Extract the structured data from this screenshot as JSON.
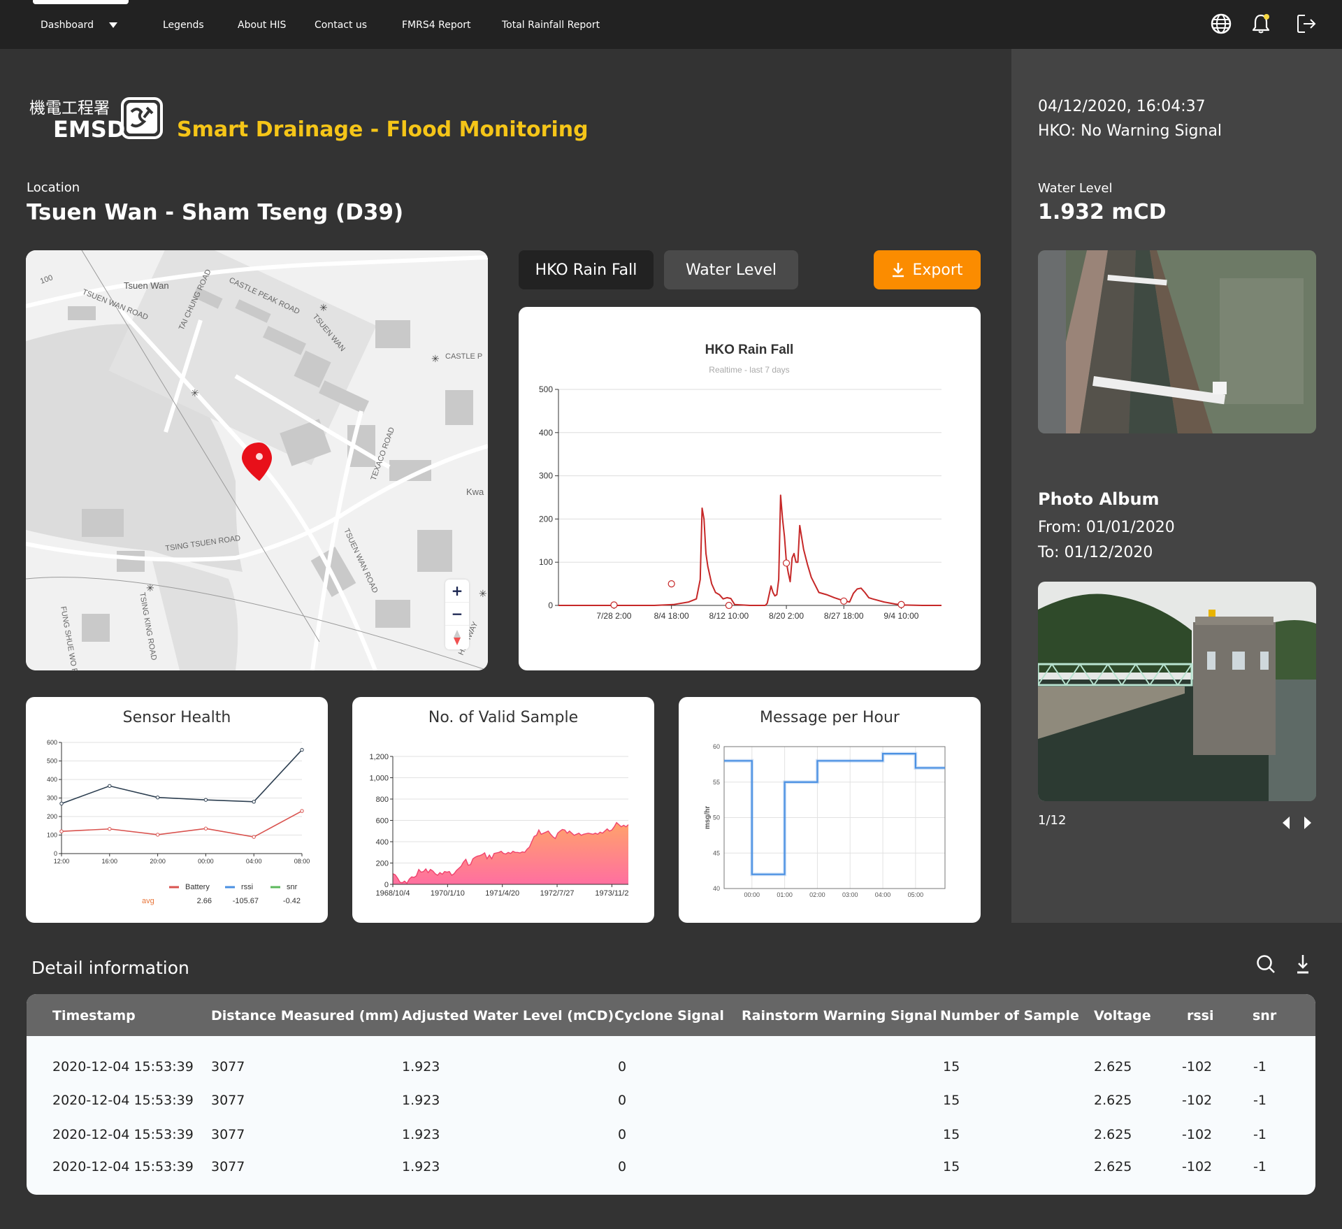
{
  "nav": {
    "items": [
      {
        "label": "Dashboard",
        "has_dropdown": true,
        "active": true
      },
      {
        "label": "Legends"
      },
      {
        "label": "About HIS"
      },
      {
        "label": "Contact us"
      },
      {
        "label": "FMRS4 Report"
      },
      {
        "label": "Total Rainfall Report"
      }
    ],
    "icons": [
      "globe-icon",
      "bell-icon",
      "logout-icon"
    ],
    "notification_dot_color": "#f5d742"
  },
  "brand": {
    "logo_chinese": "機電工程署",
    "logo_english": "EMSD",
    "app_title": "Smart Drainage - Flood Monitoring",
    "title_color": "#f5c518"
  },
  "location": {
    "label": "Location",
    "name": "Tsuen Wan - Sham Tseng (D39)"
  },
  "map": {
    "labels": [
      "Tsuen Wan",
      "TSUEN WAN ROAD",
      "CASTLE PEAK ROAD",
      "TAI CHUNG ROAD",
      "TSUEN WAN",
      "CASTLE P",
      "TEXACO ROAD",
      "TSING TSUEN ROAD",
      "TSUEN WAN ROAD",
      "TSING KING ROAD",
      "FUNG SHUE WO ROAD",
      "Kwa",
      "100",
      "HIGHWAY"
    ],
    "zoom_in": "+",
    "zoom_out": "−",
    "marker_color": "#e8101a"
  },
  "chart_tabs": {
    "tabs": [
      {
        "label": "HKO Rain Fall",
        "active": true
      },
      {
        "label": "Water Level",
        "active": false
      }
    ],
    "export_label": "Export",
    "export_color": "#fb8c00"
  },
  "right_panel": {
    "datetime": "04/12/2020, 16:04:37",
    "hko_status": "HKO: No Warning Signal",
    "water_level_label": "Water Level",
    "water_level_value": "1.932 mCD",
    "photo_album_title": "Photo Album",
    "from": "From: 01/01/2020",
    "to": "To: 01/12/2020",
    "photo_counter": "1/12"
  },
  "detail": {
    "title": "Detail information",
    "columns": [
      "Timestamp",
      "Distance Measured (mm)",
      "Adjusted Water Level (mCD)",
      "Cyclone Signal",
      "Rainstorm Warning Signal",
      "Number of Sample",
      "Voltage",
      "rssi",
      "snr"
    ],
    "rows": [
      [
        "2020-12-04 15:53:39",
        "3077",
        "1.923",
        "0",
        "",
        "15",
        "2.625",
        "-102",
        "-1"
      ],
      [
        "2020-12-04 15:53:39",
        "3077",
        "1.923",
        "0",
        "",
        "15",
        "2.625",
        "-102",
        "-1"
      ],
      [
        "2020-12-04 15:53:39",
        "3077",
        "1.923",
        "0",
        "",
        "15",
        "2.625",
        "-102",
        "-1"
      ],
      [
        "2020-12-04 15:53:39",
        "3077",
        "1.923",
        "0",
        "",
        "15",
        "2.625",
        "-102",
        "-1"
      ]
    ]
  },
  "chart_data": [
    {
      "id": "rain",
      "type": "line",
      "title": "HKO Rain Fall",
      "subtitle": "Realtime - last 7 days",
      "xlabel": "",
      "ylabel": "",
      "ylim": [
        0,
        500
      ],
      "yticks": [
        0,
        100,
        200,
        300,
        400,
        500
      ],
      "xticks": [
        "7/28 2:00",
        "8/4 18:00",
        "8/12 10:00",
        "8/20 2:00",
        "8/27 18:00",
        "9/4 10:00"
      ],
      "grid": true,
      "color": "#c62828",
      "x": [
        0,
        0.1,
        0.2,
        0.25,
        0.3,
        0.34,
        0.36,
        0.37,
        0.375,
        0.38,
        0.385,
        0.39,
        0.4,
        0.41,
        0.42,
        0.43,
        0.44,
        0.45,
        0.46,
        0.5,
        0.52,
        0.54,
        0.545,
        0.55,
        0.555,
        0.56,
        0.565,
        0.57,
        0.575,
        0.58,
        0.585,
        0.59,
        0.595,
        0.6,
        0.605,
        0.61,
        0.615,
        0.62,
        0.625,
        0.63,
        0.64,
        0.65,
        0.66,
        0.68,
        0.7,
        0.72,
        0.74,
        0.76,
        0.77,
        0.78,
        0.79,
        0.8,
        0.81,
        0.82,
        0.85,
        0.88,
        0.9,
        0.95,
        1.0
      ],
      "y": [
        0,
        0,
        0,
        0,
        2,
        8,
        15,
        60,
        225,
        200,
        120,
        90,
        50,
        30,
        25,
        15,
        18,
        16,
        2,
        0,
        0,
        0,
        5,
        25,
        45,
        30,
        22,
        25,
        60,
        255,
        200,
        160,
        100,
        75,
        55,
        110,
        120,
        100,
        100,
        185,
        130,
        95,
        65,
        30,
        25,
        18,
        12,
        8,
        28,
        38,
        40,
        30,
        18,
        15,
        8,
        3,
        1,
        0,
        0
      ],
      "markers_x": [
        0.145,
        0.295,
        0.445,
        0.595,
        0.745,
        0.895
      ],
      "markers_y": [
        1,
        50,
        0,
        98,
        10,
        2
      ]
    },
    {
      "id": "sensor",
      "type": "line",
      "title": "Sensor Health",
      "categories": [
        "12:00",
        "16:00",
        "20:00",
        "00:00",
        "04:00",
        "08:00"
      ],
      "ylim": [
        0,
        600
      ],
      "yticks": [
        0,
        100,
        200,
        300,
        400,
        500,
        600
      ],
      "grid": true,
      "series": [
        {
          "name": "dark",
          "color": "#2c3e50",
          "values": [
            270,
            365,
            303,
            290,
            280,
            560
          ]
        },
        {
          "name": "red",
          "color": "#d9534f",
          "values": [
            120,
            133,
            102,
            135,
            90,
            230
          ]
        }
      ],
      "legend": [
        {
          "name": "Battery",
          "color": "#d9534f",
          "avg": "2.66"
        },
        {
          "name": "rssi",
          "color": "#4a90e2",
          "avg": "-105.67"
        },
        {
          "name": "snr",
          "color": "#5cb85c",
          "avg": "-0.42"
        }
      ],
      "avg_label": "avg",
      "avg_color": "#e8763a"
    },
    {
      "id": "samples",
      "type": "area",
      "title": "No. of Valid Sample",
      "xticks": [
        "1968/10/4",
        "1970/1/10",
        "1971/4/20",
        "1972/7/27",
        "1973/11/2"
      ],
      "ylim": [
        0,
        1200
      ],
      "yticks": [
        0,
        200,
        400,
        600,
        800,
        1000,
        1200
      ],
      "ytick_labels": [
        "0",
        "200",
        "400",
        "600",
        "800",
        "1,000",
        "1,200"
      ],
      "grid": true,
      "color_top": "#ffa26b",
      "color_bottom": "#ff6fa0",
      "line_color": "#f0436e",
      "x": [
        0,
        0.01,
        0.02,
        0.03,
        0.04,
        0.05,
        0.06,
        0.07,
        0.08,
        0.09,
        0.1,
        0.11,
        0.12,
        0.13,
        0.14,
        0.15,
        0.16,
        0.17,
        0.18,
        0.19,
        0.2,
        0.21,
        0.22,
        0.23,
        0.24,
        0.25,
        0.26,
        0.27,
        0.28,
        0.29,
        0.3,
        0.31,
        0.32,
        0.33,
        0.34,
        0.35,
        0.36,
        0.37,
        0.38,
        0.39,
        0.4,
        0.41,
        0.42,
        0.43,
        0.44,
        0.45,
        0.46,
        0.47,
        0.48,
        0.49,
        0.5,
        0.51,
        0.52,
        0.53,
        0.54,
        0.55,
        0.56,
        0.57,
        0.58,
        0.59,
        0.6,
        0.61,
        0.62,
        0.63,
        0.64,
        0.65,
        0.66,
        0.67,
        0.68,
        0.69,
        0.7,
        0.71,
        0.72,
        0.73,
        0.74,
        0.75,
        0.76,
        0.77,
        0.78,
        0.79,
        0.8,
        0.81,
        0.82,
        0.83,
        0.84,
        0.85,
        0.86,
        0.87,
        0.88,
        0.89,
        0.9,
        0.91,
        0.92,
        0.93,
        0.94,
        0.95,
        0.96,
        0.97,
        0.98,
        0.99,
        1.0
      ],
      "y": [
        100,
        90,
        60,
        20,
        15,
        30,
        10,
        50,
        70,
        65,
        80,
        140,
        115,
        120,
        145,
        110,
        140,
        125,
        100,
        85,
        110,
        95,
        120,
        115,
        120,
        85,
        100,
        130,
        150,
        170,
        210,
        235,
        180,
        185,
        240,
        255,
        265,
        270,
        280,
        295,
        240,
        275,
        240,
        290,
        295,
        300,
        310,
        290,
        285,
        300,
        290,
        310,
        300,
        300,
        295,
        305,
        300,
        330,
        350,
        400,
        450,
        460,
        510,
        470,
        480,
        490,
        500,
        470,
        445,
        430,
        480,
        500,
        515,
        510,
        480,
        500,
        480,
        460,
        470,
        480,
        460,
        470,
        475,
        480,
        475,
        470,
        480,
        470,
        490,
        480,
        500,
        520,
        500,
        510,
        540,
        580,
        560,
        540,
        555,
        540,
        560
      ]
    },
    {
      "id": "msg",
      "type": "line",
      "step": true,
      "title": "Message per Hour",
      "ylabel": "msg/hr",
      "ylim": [
        40,
        60
      ],
      "yticks": [
        40,
        45,
        50,
        55,
        60
      ],
      "xticks": [
        "00:00",
        "01:00",
        "02:00",
        "03:00",
        "04:00",
        "05:00"
      ],
      "grid": true,
      "color": "#4a90e2",
      "x_hours": [
        -0.85,
        0,
        1,
        2,
        3,
        4,
        5,
        5.9
      ],
      "values": [
        58,
        42,
        55,
        58,
        58,
        59,
        57,
        57
      ]
    }
  ]
}
